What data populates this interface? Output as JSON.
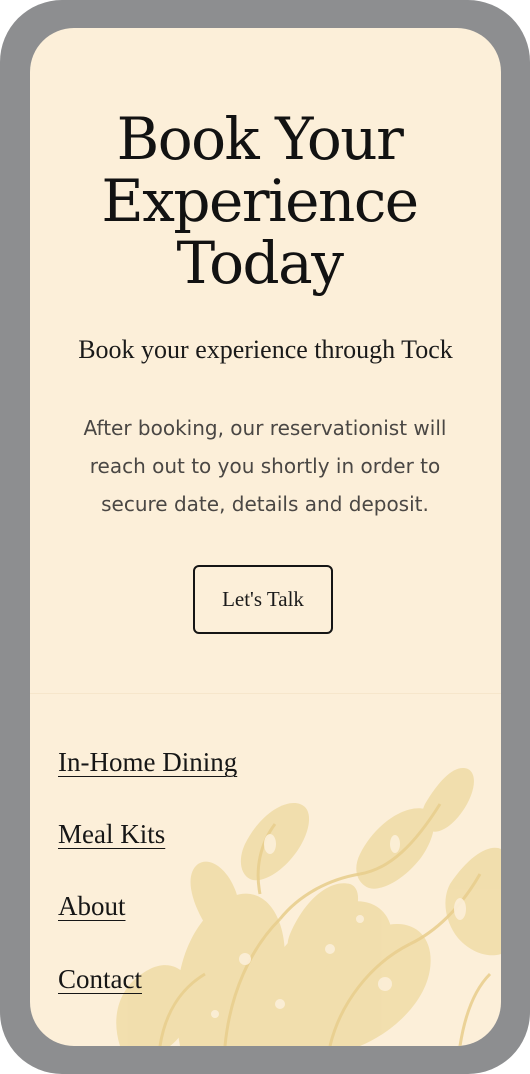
{
  "hero": {
    "headline_line1": "Book Your",
    "headline_line2": "Experience",
    "headline_line3": "Today",
    "subheading": "Book your experience through Tock",
    "body_line1": "After booking, our reservationist will",
    "body_line2": "reach out to you shortly in order to",
    "body_line3": "secure date, details and deposit.",
    "cta_label": "Let's Talk"
  },
  "footer_nav": {
    "items": [
      {
        "label": "In-Home Dining"
      },
      {
        "label": "Meal Kits"
      },
      {
        "label": "About"
      },
      {
        "label": "Contact"
      }
    ],
    "background_icon": "floral-illustration"
  },
  "colors": {
    "device_frame": "#8d8e90",
    "page_background": "#fcefd9",
    "text_dark": "#121212",
    "text_body": "#4a4744",
    "floral_tint": "#f0dca6"
  }
}
